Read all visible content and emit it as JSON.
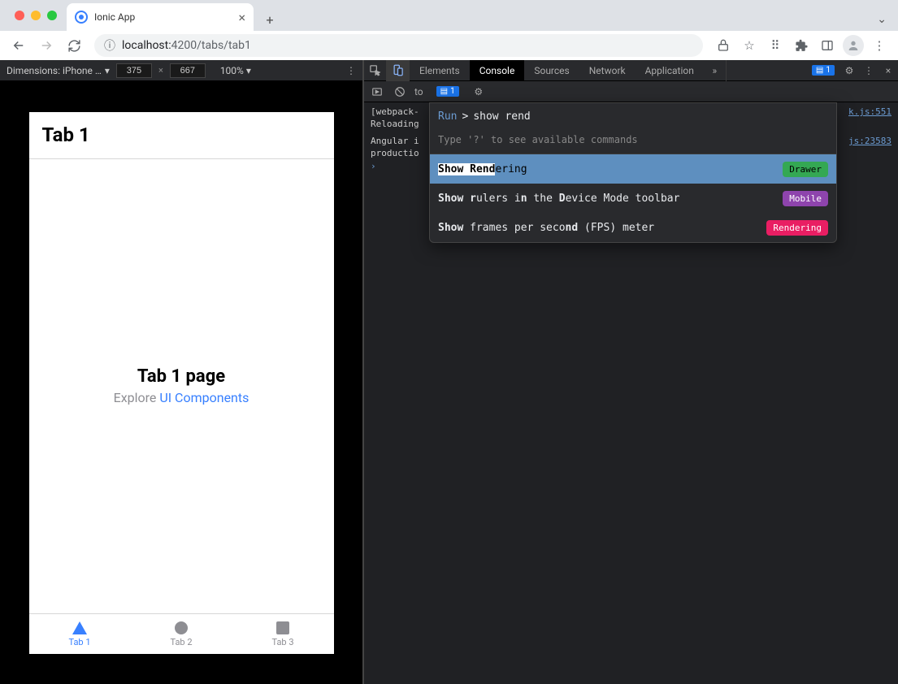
{
  "browser": {
    "tab_title": "Ionic App",
    "url_host": "localhost:",
    "url_port_path": "4200/tabs/tab1"
  },
  "device_toolbar": {
    "dimensions_label": "Dimensions: iPhone …",
    "width": "375",
    "height": "667",
    "zoom": "100%"
  },
  "app": {
    "header": "Tab 1",
    "content_title": "Tab 1 page",
    "content_subtitle_prefix": "Explore ",
    "content_subtitle_link": "UI Components",
    "tabs": [
      "Tab 1",
      "Tab 2",
      "Tab 3"
    ]
  },
  "devtools": {
    "tabs": [
      "Elements",
      "Console",
      "Sources",
      "Network",
      "Application"
    ],
    "active_tab": "Console",
    "issues_badge": "1",
    "sub_issues_badge": "1",
    "subbar_context": "to",
    "console_lines": [
      {
        "text": "[webpack-",
        "src": "k.js:551"
      },
      {
        "text": "Reloading"
      },
      {
        "text": "Angular i",
        "src": "js:23583"
      },
      {
        "text": "productio"
      }
    ]
  },
  "command_palette": {
    "run_label": "Run",
    "prompt_char": ">",
    "query": "show rend",
    "hint": "Type '?' to see available commands",
    "items": [
      {
        "bold": "Show Rend",
        "rest": "ering",
        "tag": "Drawer",
        "tag_class": "tag-drawer",
        "selected": true
      },
      {
        "bold_parts": [
          "Show r",
          "d",
          "D"
        ],
        "full": "Show rulers in the Device Mode toolbar",
        "tag": "Mobile",
        "tag_class": "tag-mobile"
      },
      {
        "bold_parts": [
          "Show",
          "nd"
        ],
        "full": "Show frames per second (FPS) meter",
        "tag": "Rendering",
        "tag_class": "tag-rendering"
      }
    ]
  }
}
